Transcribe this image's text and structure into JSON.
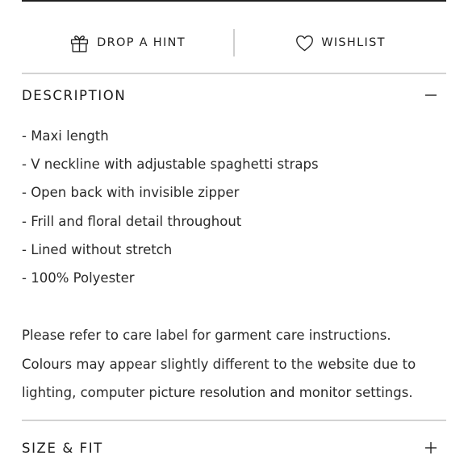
{
  "actions": {
    "drop_hint": {
      "label": "DROP A HINT",
      "icon": "gift-icon"
    },
    "wishlist": {
      "label": "WISHLIST",
      "icon": "heart-icon"
    }
  },
  "description": {
    "title": "DESCRIPTION",
    "expanded": true,
    "toggle_icon": "minus-icon",
    "items": [
      "- Maxi length",
      "- V neckline with adjustable spaghetti straps",
      "- Open back with invisible zipper",
      "- Frill and floral detail throughout",
      "- Lined without stretch",
      "- 100% Polyester"
    ],
    "care_lines": [
      "Please refer to care label for garment care instructions.",
      "Colours may appear slightly different to the website due to",
      "lighting, computer picture resolution and monitor settings."
    ]
  },
  "size_fit": {
    "title": "SIZE & FIT",
    "expanded": false,
    "toggle_icon": "plus-icon"
  }
}
